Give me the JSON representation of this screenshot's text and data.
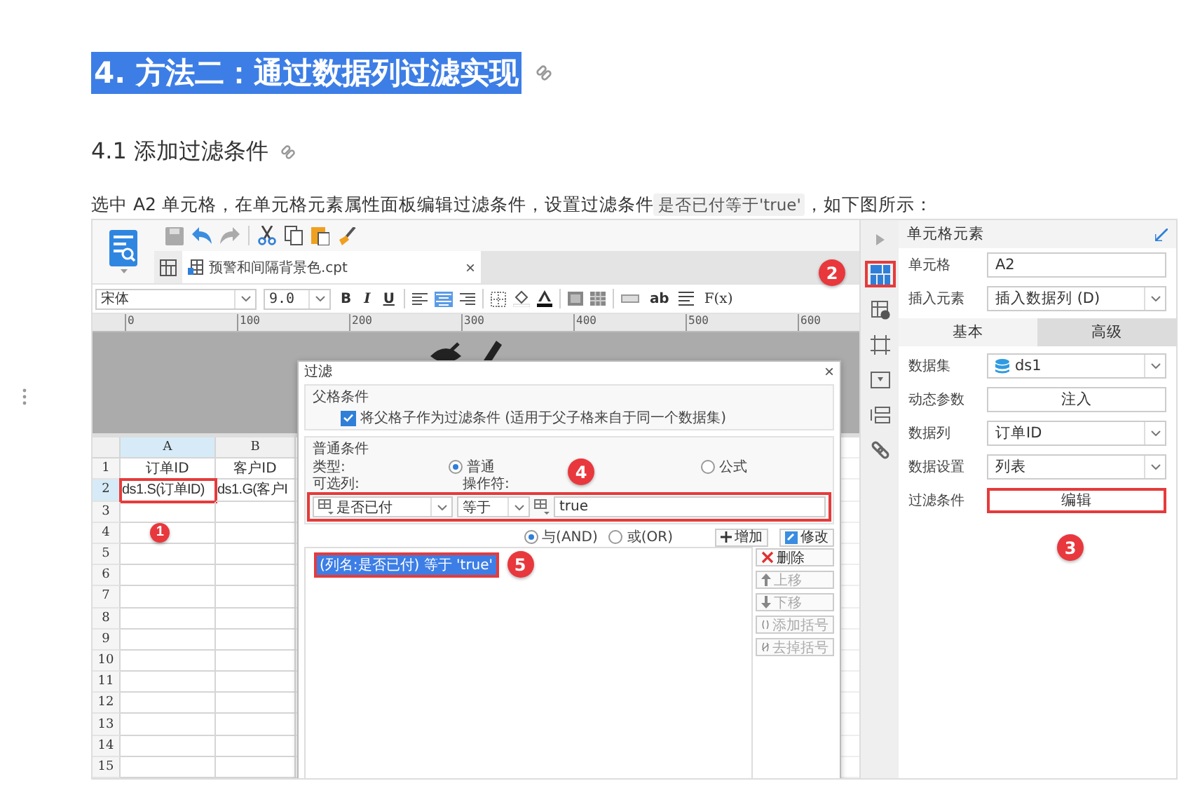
{
  "heading": {
    "text": "4. 方法二：通过数据列过滤实现",
    "selected": true
  },
  "subheading": "4.1 添加过滤条件",
  "paragraph": {
    "text": "选中 A2 单元格，在单元格元素属性面板编辑过滤条件，设置过滤条件",
    "code": "是否已付等于'true'",
    "tail": "，如下图所示："
  },
  "screenshot": {
    "file_tab": {
      "title": "预警和间隔背景色.cpt",
      "close": "×"
    },
    "font": "宋体",
    "font_size": "9.0",
    "style_buttons": [
      "B",
      "I",
      "U"
    ],
    "wrap_button": "ab",
    "formula_button": "F(x)",
    "ruler_ticks": [
      "0",
      "100",
      "200",
      "300",
      "400",
      "500",
      "600"
    ],
    "sheet": {
      "columns": [
        {
          "label": "A",
          "selected": true
        },
        {
          "label": "B",
          "selected": false
        }
      ],
      "rows": [
        {
          "number": "1",
          "selected": false,
          "cells": [
            {
              "text": "订单ID",
              "outlined": false
            },
            {
              "text": "客户ID",
              "outlined": false
            }
          ]
        },
        {
          "number": "2",
          "selected": true,
          "cells": [
            {
              "text": "ds1.S(订单ID)",
              "outlined": true
            },
            {
              "text": "ds1.G(客户I",
              "outlined": false
            }
          ]
        },
        {
          "number": "3",
          "selected": false
        },
        {
          "number": "4",
          "selected": false,
          "badge": "1"
        },
        {
          "number": "5",
          "selected": false
        },
        {
          "number": "6",
          "selected": false
        },
        {
          "number": "7",
          "selected": false
        },
        {
          "number": "8",
          "selected": false
        },
        {
          "number": "9",
          "selected": false
        },
        {
          "number": "10",
          "selected": false
        },
        {
          "number": "11",
          "selected": false
        },
        {
          "number": "12",
          "selected": false
        },
        {
          "number": "13",
          "selected": false
        },
        {
          "number": "14",
          "selected": false
        },
        {
          "number": "15",
          "selected": false
        }
      ]
    },
    "dialog": {
      "title": "过滤",
      "close": "×",
      "parent_section": {
        "title": "父格条件",
        "checkbox": {
          "label": "将父格子作为过滤条件 (适用于父子格来自于同一个数据集)",
          "checked": true
        }
      },
      "normal_section": {
        "title": "普通条件",
        "type_label": "类型:",
        "type_options": [
          {
            "label": "普通",
            "selected": true
          },
          {
            "label": "公式",
            "selected": false
          }
        ],
        "column_label": "可选列:",
        "operator_label": "操作符:",
        "column": "是否已付",
        "operator": "等于",
        "value": "true",
        "outlined": true,
        "badge": "4"
      },
      "joins": [
        {
          "label": "与(AND)",
          "selected": true
        },
        {
          "label": "或(OR)",
          "selected": false
        }
      ],
      "add_button": "增加",
      "edit_button": "修改",
      "conditions": [
        {
          "text": "(列名:是否已付) 等于 'true'",
          "selected": true,
          "outlined": true
        }
      ],
      "list_badge": "5",
      "side_buttons": [
        {
          "kind": "delete",
          "label": "删除",
          "disabled": false
        },
        {
          "kind": "up",
          "label": "上移",
          "disabled": true
        },
        {
          "kind": "down",
          "label": "下移",
          "disabled": true
        },
        {
          "kind": "add-bracket",
          "label": "添加括号",
          "disabled": true
        },
        {
          "kind": "remove-bracket",
          "label": "去掉括号",
          "disabled": true
        }
      ]
    },
    "tool_strip": {
      "items": [
        {
          "kind": "collapse",
          "selected": false
        },
        {
          "kind": "cell",
          "selected": true
        },
        {
          "kind": "cell-info",
          "selected": false
        },
        {
          "kind": "frame",
          "selected": false
        },
        {
          "kind": "widget",
          "selected": false
        },
        {
          "kind": "list",
          "selected": false
        },
        {
          "kind": "link",
          "selected": false
        }
      ],
      "badge": "2"
    },
    "panel": {
      "title": "单元格元素",
      "top_fields": [
        {
          "kind": "input",
          "label": "单元格",
          "value": "A2",
          "outlined": false
        },
        {
          "kind": "select",
          "label": "插入元素",
          "value": "插入数据列 (D)",
          "outlined": false
        }
      ],
      "tabs": [
        {
          "label": "基本",
          "selected": true
        },
        {
          "label": "高级",
          "selected": false
        }
      ],
      "fields": [
        {
          "kind": "dataset",
          "label": "数据集",
          "value": "ds1",
          "outlined": false
        },
        {
          "kind": "button",
          "label": "动态参数",
          "value": "注入",
          "outlined": false
        },
        {
          "kind": "select",
          "label": "数据列",
          "value": "订单ID",
          "outlined": false
        },
        {
          "kind": "select",
          "label": "数据设置",
          "value": "列表",
          "outlined": false
        },
        {
          "kind": "button",
          "label": "过滤条件",
          "value": "编辑",
          "outlined": true
        }
      ],
      "badge": "3"
    }
  }
}
